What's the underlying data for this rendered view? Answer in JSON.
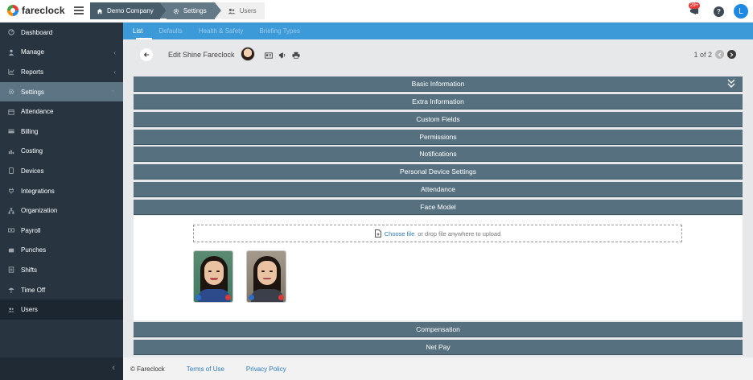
{
  "app": {
    "brand": "fareclock"
  },
  "breadcrumb": [
    {
      "label": "Demo Company",
      "icon": "home-icon"
    },
    {
      "label": "Settings",
      "icon": "gear-icon"
    },
    {
      "label": "Users",
      "icon": "users-icon"
    }
  ],
  "topbar": {
    "notification_count": "29+",
    "help_label": "?",
    "user_initial": "L"
  },
  "sidebar": {
    "items": [
      {
        "label": "Dashboard",
        "icon": "dashboard-icon"
      },
      {
        "label": "Manage",
        "icon": "person-icon",
        "chevron": "‹"
      },
      {
        "label": "Reports",
        "icon": "chart-icon",
        "chevron": "‹"
      },
      {
        "label": "Settings",
        "icon": "gear-icon",
        "chevron": "⌄"
      },
      {
        "label": "Attendance",
        "icon": "calendar-icon"
      },
      {
        "label": "Billing",
        "icon": "credit-card-icon"
      },
      {
        "label": "Costing",
        "icon": "bar-chart-icon"
      },
      {
        "label": "Devices",
        "icon": "tablet-icon"
      },
      {
        "label": "Integrations",
        "icon": "plug-icon"
      },
      {
        "label": "Organization",
        "icon": "sitemap-icon"
      },
      {
        "label": "Payroll",
        "icon": "money-icon"
      },
      {
        "label": "Punches",
        "icon": "punch-icon"
      },
      {
        "label": "Shifts",
        "icon": "shift-icon"
      },
      {
        "label": "Time Off",
        "icon": "umbrella-icon"
      },
      {
        "label": "Users",
        "icon": "users-icon"
      }
    ],
    "collapse_glyph": "‹"
  },
  "subtabs": [
    "List",
    "Defaults",
    "Health & Safety",
    "Briefing Types"
  ],
  "header": {
    "title": "Edit Shine Fareclock",
    "pager_text": "1 of 2"
  },
  "sections_top": [
    "Basic Information",
    "Extra Information",
    "Custom Fields",
    "Permissions",
    "Notifications",
    "Personal Device Settings",
    "Attendance",
    "Face Model"
  ],
  "face_model": {
    "choose_file": "Choose file",
    "drop_text": "or drop file anywhere to upload",
    "photos": [
      "face-photo-1",
      "face-photo-2"
    ]
  },
  "sections_bottom": [
    "Compensation",
    "Net Pay"
  ],
  "footer": {
    "copyright": "© Fareclock",
    "terms": "Terms of Use",
    "privacy": "Privacy Policy"
  },
  "colors": {
    "sidebar_bg": "#283541",
    "sidebar_active": "#5c7483",
    "subtab_bar": "#3c9ad8",
    "section_bar": "#56707f",
    "link": "#2a7bc0"
  }
}
